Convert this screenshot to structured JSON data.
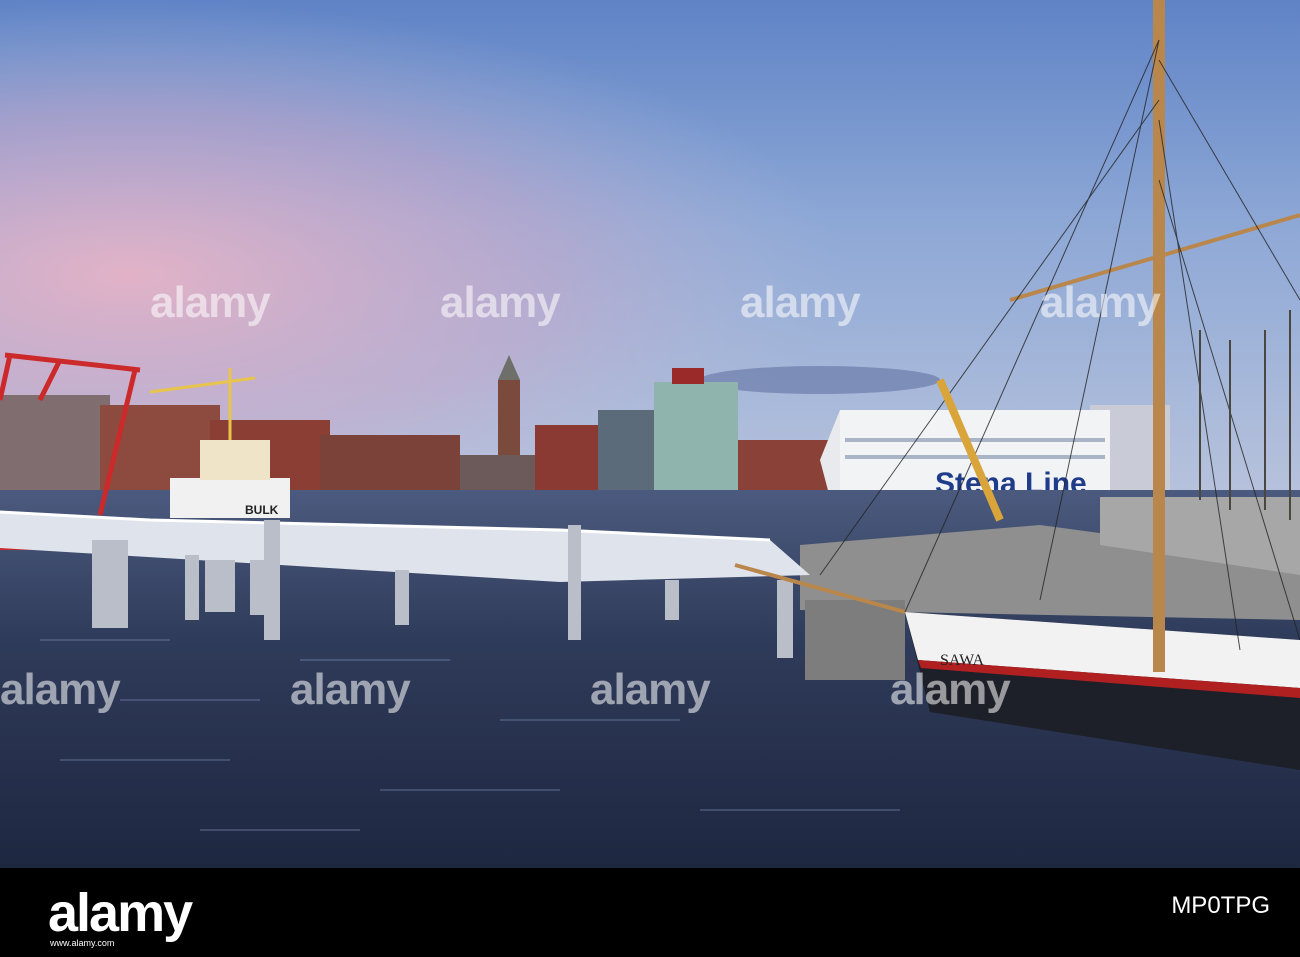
{
  "photo": {
    "subject": "harbour-scene",
    "vessel_name": "SAWA",
    "ferry_livery": "Stena Line",
    "tug_name": "BULK"
  },
  "watermark": {
    "text": "alamy"
  },
  "footer": {
    "logo": "alamy",
    "image_id": "MP0TPG",
    "url": "www.alamy.com"
  },
  "colors": {
    "sky_top": "#6f8fc9",
    "sky_pink": "#d9a8c0",
    "water": "#2a3550",
    "footer_bg": "#000000"
  }
}
